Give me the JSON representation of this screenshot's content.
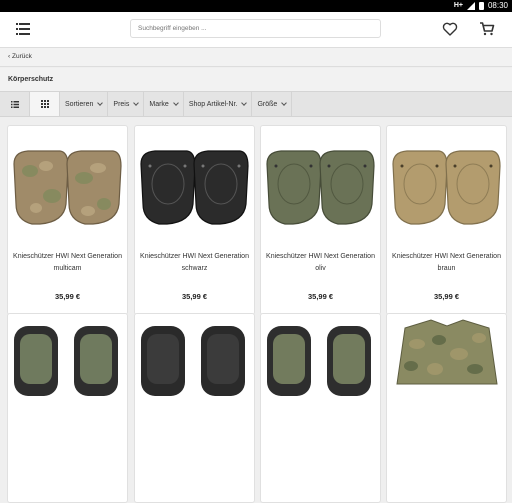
{
  "status_bar": {
    "network": "H+",
    "time": "08:30"
  },
  "header": {
    "search_placeholder": "Suchbegriff eingeben ..."
  },
  "nav": {
    "back_label": "Zurück"
  },
  "page": {
    "title": "Körperschutz"
  },
  "filter_bar": {
    "sort_label": "Sortieren",
    "price_label": "Preis",
    "brand_label": "Marke",
    "sku_label": "Shop Artikel-Nr.",
    "size_label": "Größe"
  },
  "products": [
    {
      "name": "Knieschützer HWI Next Generation multicam",
      "price": "35,99 €",
      "color": "#a08b69"
    },
    {
      "name": "Knieschützer HWI Next Generation schwarz",
      "price": "35,99 €",
      "color": "#2b2b2b"
    },
    {
      "name": "Knieschützer HWI Next Generation oliv",
      "price": "35,99 €",
      "color": "#6a7256"
    },
    {
      "name": "Knieschützer HWI Next Generation braun",
      "price": "35,99 €",
      "color": "#b39c6e"
    }
  ],
  "colors": {
    "accent": "#333333",
    "background": "#efefef"
  }
}
